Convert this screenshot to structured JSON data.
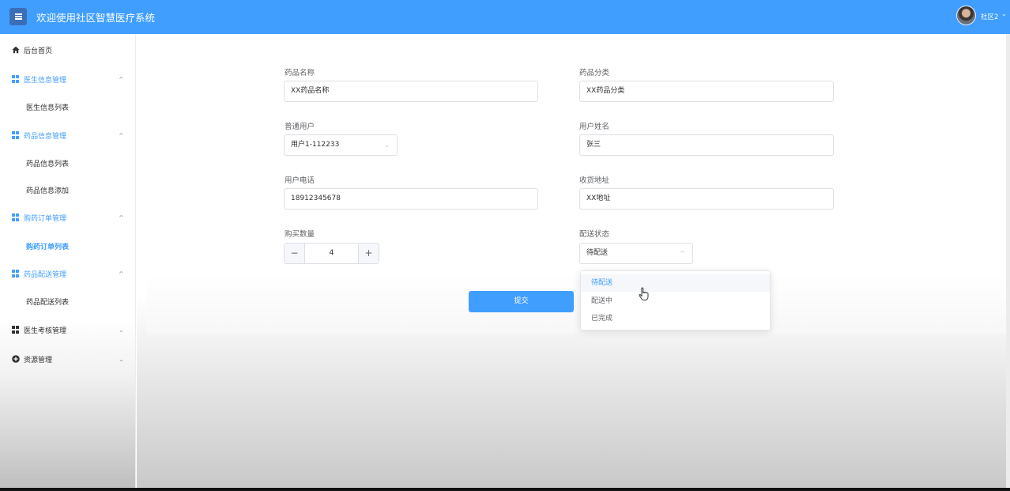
{
  "header": {
    "title": "欢迎使用社区智慧医疗系统",
    "user_name": "社区2"
  },
  "colors": {
    "primary": "#409eff",
    "text": "#606266"
  },
  "sidebar": {
    "items": [
      {
        "label": "后台首页",
        "icon": "home-icon"
      },
      {
        "label": "医生信息管理",
        "icon": "grid-icon",
        "sub": [
          "医生信息列表"
        ]
      },
      {
        "label": "药品信息管理",
        "icon": "grid-icon",
        "sub": [
          "药品信息列表",
          "药品信息添加"
        ]
      },
      {
        "label": "购药订单管理",
        "icon": "grid-icon",
        "sub": [
          "购药订单列表"
        ]
      },
      {
        "label": "药品配送管理",
        "icon": "grid-icon",
        "sub": [
          "药品配送列表"
        ]
      },
      {
        "label": "医生考核管理",
        "icon": "grid-icon"
      },
      {
        "label": "资源管理",
        "icon": "plus-circle-icon"
      }
    ]
  },
  "form": {
    "drug_name": {
      "label": "药品名称",
      "value": "XX药品名称"
    },
    "drug_category": {
      "label": "药品分类",
      "value": "XX药品分类"
    },
    "normal_user": {
      "label": "普通用户",
      "value": "用户1-112233"
    },
    "user_realname": {
      "label": "用户姓名",
      "value": "张三"
    },
    "user_phone": {
      "label": "用户电话",
      "value": "18912345678"
    },
    "address": {
      "label": "收货地址",
      "value": "XX地址"
    },
    "quantity": {
      "label": "购买数量",
      "value": "4",
      "minus": "−",
      "plus": "+"
    },
    "delivery_status": {
      "label": "配送状态",
      "value": "待配送",
      "options": [
        "待配送",
        "配送中",
        "已完成"
      ]
    },
    "submit_label": "提交"
  }
}
